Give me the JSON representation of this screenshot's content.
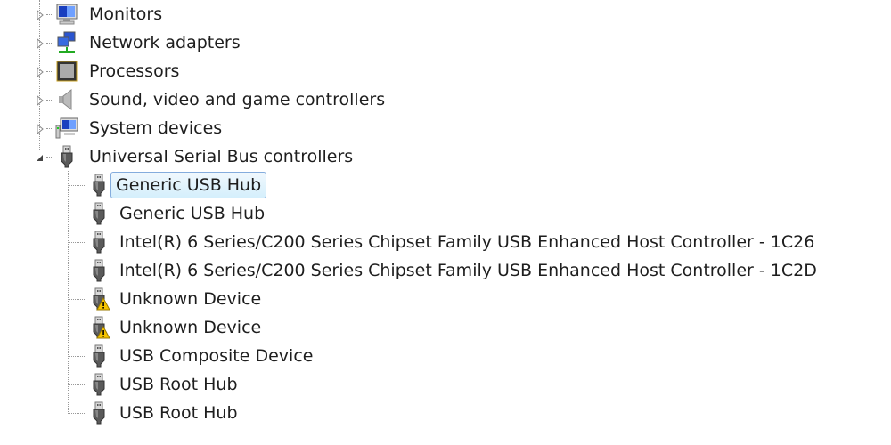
{
  "tree": {
    "categories": [
      {
        "label": "Monitors",
        "icon": "monitor-icon",
        "expanded": false
      },
      {
        "label": "Network adapters",
        "icon": "network-adapter-icon",
        "expanded": false
      },
      {
        "label": "Processors",
        "icon": "processor-icon",
        "expanded": false
      },
      {
        "label": "Sound, video and game controllers",
        "icon": "speaker-icon",
        "expanded": false
      },
      {
        "label": "System devices",
        "icon": "system-devices-icon",
        "expanded": false
      },
      {
        "label": "Universal Serial Bus controllers",
        "icon": "usb-icon",
        "expanded": true
      }
    ],
    "usb_children": [
      {
        "label": "Generic USB Hub",
        "warning": false,
        "selected": true
      },
      {
        "label": "Generic USB Hub",
        "warning": false
      },
      {
        "label": "Intel(R) 6 Series/C200 Series Chipset Family USB Enhanced Host Controller - 1C26",
        "warning": false
      },
      {
        "label": "Intel(R) 6 Series/C200 Series Chipset Family USB Enhanced Host Controller - 1C2D",
        "warning": false
      },
      {
        "label": "Unknown Device",
        "warning": true
      },
      {
        "label": "Unknown Device",
        "warning": true
      },
      {
        "label": "USB Composite Device",
        "warning": false
      },
      {
        "label": "USB Root Hub",
        "warning": false
      },
      {
        "label": "USB Root Hub",
        "warning": false
      }
    ]
  },
  "colors": {
    "selection_border": "#84acdd",
    "selection_bg": "#d5effc",
    "warning": "#f5c400"
  }
}
